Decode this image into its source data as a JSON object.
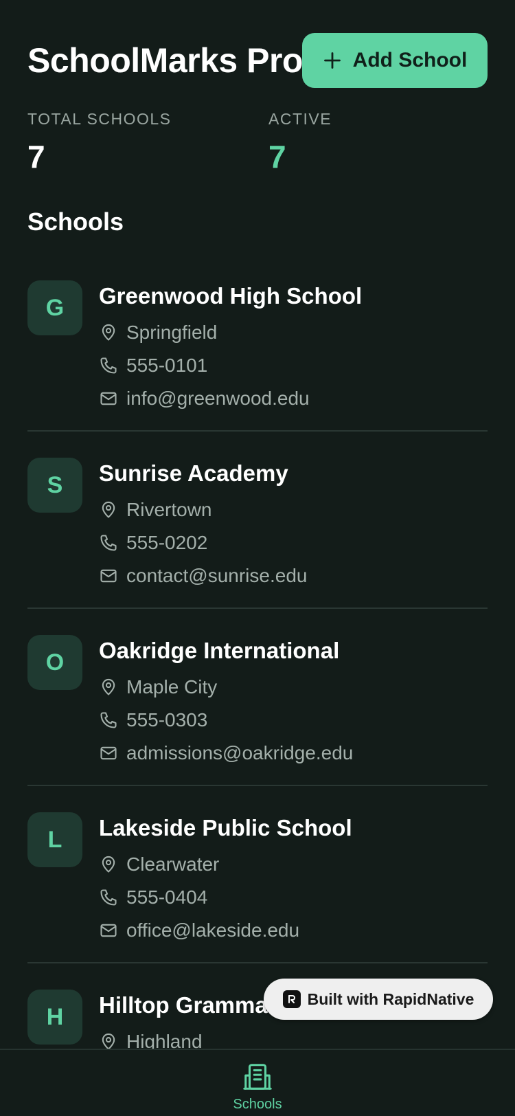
{
  "header": {
    "title": "SchoolMarks Pro",
    "add_button_label": "Add School"
  },
  "stats": {
    "total_label": "TOTAL SCHOOLS",
    "total_value": "7",
    "active_label": "ACTIVE",
    "active_value": "7"
  },
  "section_title": "Schools",
  "schools": [
    {
      "initial": "G",
      "name": "Greenwood High School",
      "city": "Springfield",
      "phone": "555-0101",
      "email": "info@greenwood.edu"
    },
    {
      "initial": "S",
      "name": "Sunrise Academy",
      "city": "Rivertown",
      "phone": "555-0202",
      "email": "contact@sunrise.edu"
    },
    {
      "initial": "O",
      "name": "Oakridge International",
      "city": "Maple City",
      "phone": "555-0303",
      "email": "admissions@oakridge.edu"
    },
    {
      "initial": "L",
      "name": "Lakeside Public School",
      "city": "Clearwater",
      "phone": "555-0404",
      "email": "office@lakeside.edu"
    },
    {
      "initial": "H",
      "name": "Hilltop Gramma",
      "city": "Highland",
      "phone": "",
      "email": ""
    }
  ],
  "badge": {
    "label": "Built with RapidNative"
  },
  "tabbar": {
    "tab_label": "Schools"
  },
  "colors": {
    "accent": "#5fd3a3",
    "background": "#131c19",
    "avatar_bg": "#1f3a31"
  },
  "icons": {
    "plus": "plus-icon",
    "location": "map-pin-icon",
    "phone": "phone-icon",
    "email": "mail-icon",
    "tab": "school-building-icon"
  }
}
